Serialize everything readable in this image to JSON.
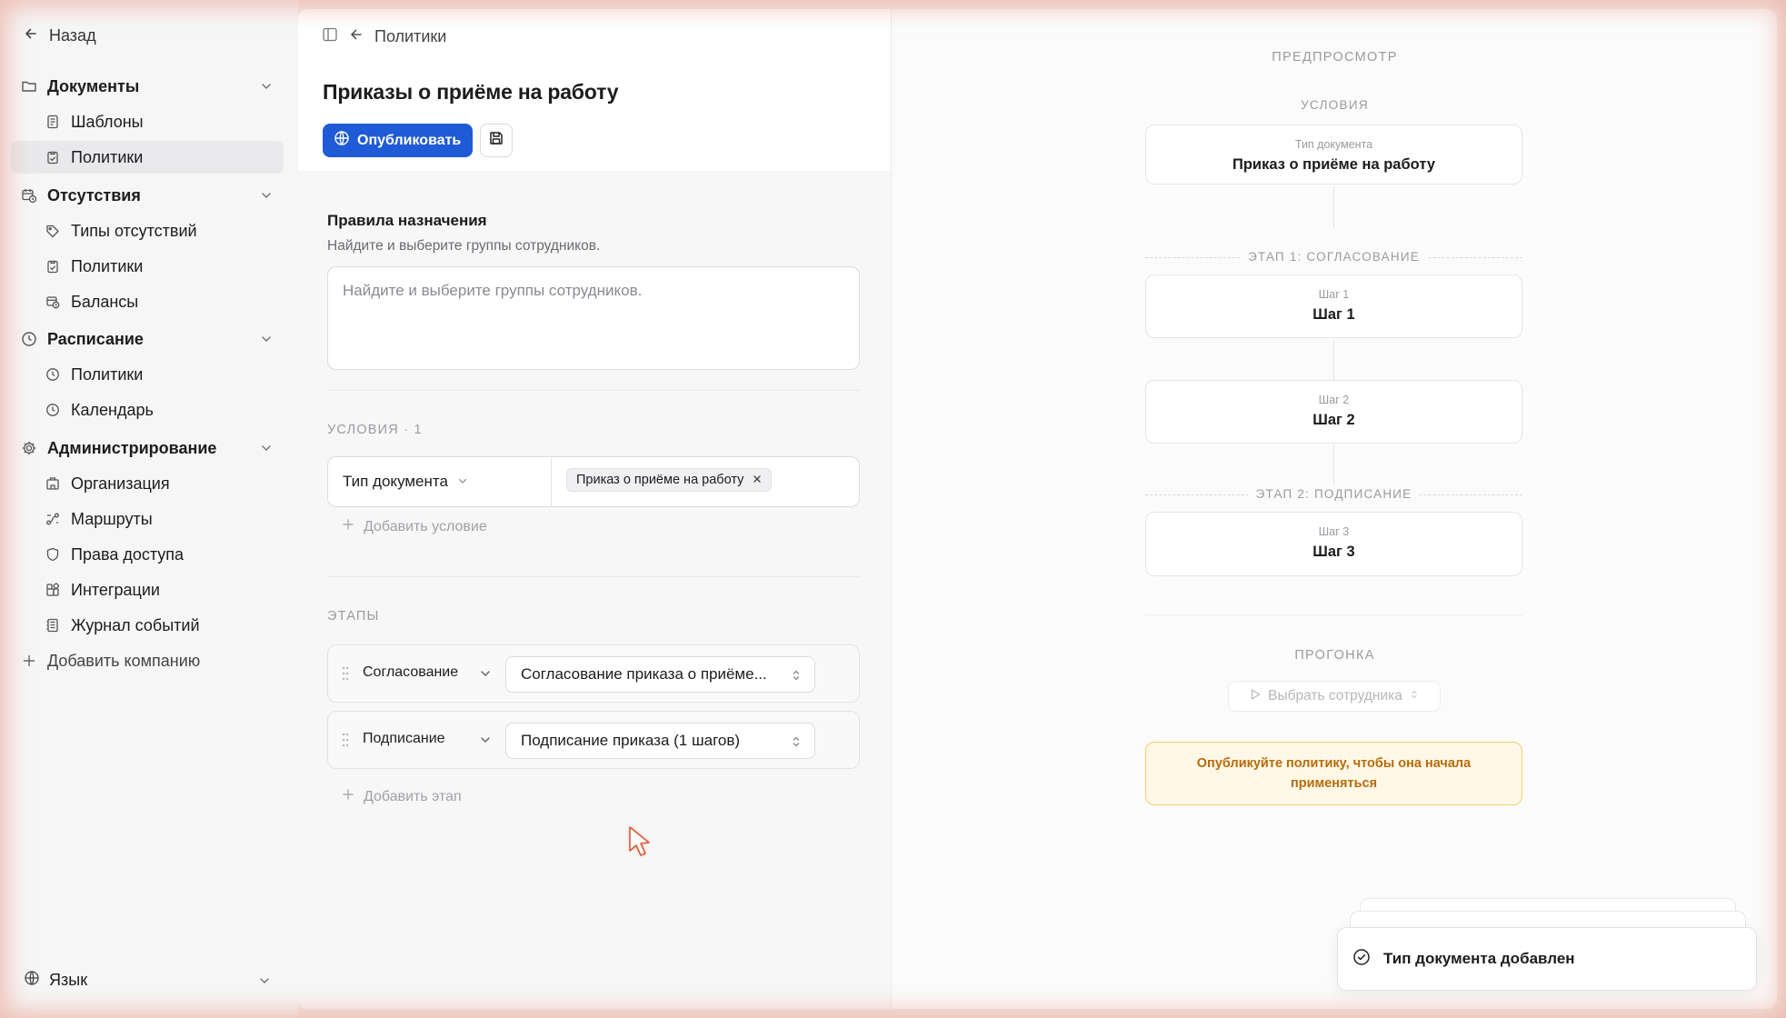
{
  "sidebar": {
    "back_label": "Назад",
    "groups": [
      {
        "label": "Документы",
        "icon": "folder-icon",
        "items": [
          {
            "label": "Шаблоны",
            "icon": "file-text-icon"
          },
          {
            "label": "Политики",
            "icon": "clipboard-check-icon",
            "active": true
          }
        ]
      },
      {
        "label": "Отсутствия",
        "icon": "calendar-clock-icon",
        "items": [
          {
            "label": "Типы отсутствий",
            "icon": "tag-icon"
          },
          {
            "label": "Политики",
            "icon": "clipboard-check-icon"
          },
          {
            "label": "Балансы",
            "icon": "calendar-clock-icon"
          }
        ]
      },
      {
        "label": "Расписание",
        "icon": "clock-icon",
        "items": [
          {
            "label": "Политики",
            "icon": "clock-icon"
          },
          {
            "label": "Календарь",
            "icon": "clock-icon"
          }
        ]
      },
      {
        "label": "Администрирование",
        "icon": "gear-icon",
        "items": [
          {
            "label": "Организация",
            "icon": "building-icon"
          },
          {
            "label": "Маршруты",
            "icon": "route-icon"
          },
          {
            "label": "Права доступа",
            "icon": "shield-icon"
          },
          {
            "label": "Интеграции",
            "icon": "puzzle-icon"
          },
          {
            "label": "Журнал событий",
            "icon": "log-icon"
          }
        ]
      }
    ],
    "add_company": "Добавить компанию",
    "language": "Язык"
  },
  "main": {
    "breadcrumb": "Политики",
    "title": "Приказы о приёме на работу",
    "publish_label": "Опубликовать",
    "rules": {
      "title": "Правила назначения",
      "subtitle": "Найдите и выберите группы сотрудников.",
      "placeholder": "Найдите и выберите группы сотрудников."
    },
    "conditions": {
      "caption": "УСЛОВИЯ · 1",
      "field": "Тип документа",
      "chip": "Приказ о приёме на работу",
      "add_label": "Добавить условие"
    },
    "stages": {
      "caption": "ЭТАПЫ",
      "rows": [
        {
          "name": "Согласование",
          "value": "Согласование приказа о приёме..."
        },
        {
          "name": "Подписание",
          "value": "Подписание приказа (1 шагов)"
        }
      ],
      "add_label": "Добавить этап"
    }
  },
  "preview": {
    "caption": "ПРЕДПРОСМОТР",
    "conditions_caption": "УСЛОВИЯ",
    "condition_card": {
      "label": "Тип документа",
      "value": "Приказ о приёме на работу"
    },
    "stage1_caption": "ЭТАП 1: СОГЛАСОВАНИЕ",
    "step1": {
      "label": "Шаг 1",
      "value": "Шаг 1"
    },
    "step2": {
      "label": "Шаг 2",
      "value": "Шаг 2"
    },
    "stage2_caption": "ЭТАП 2: ПОДПИСАНИЕ",
    "step3": {
      "label": "Шаг 3",
      "value": "Шаг 3"
    },
    "run_caption": "ПРОГОНКА",
    "select_employee": "Выбрать сотрудника",
    "warning_line1": "Опубликуйте политику, чтобы она начала",
    "warning_line2": "применяться"
  },
  "toast": {
    "message": "Тип документа добавлен",
    "icon": "check-circle-icon"
  },
  "colors": {
    "accent": "#1f5bd6",
    "warning_text": "#b86b0b",
    "warning_border": "#f3cf6e"
  }
}
